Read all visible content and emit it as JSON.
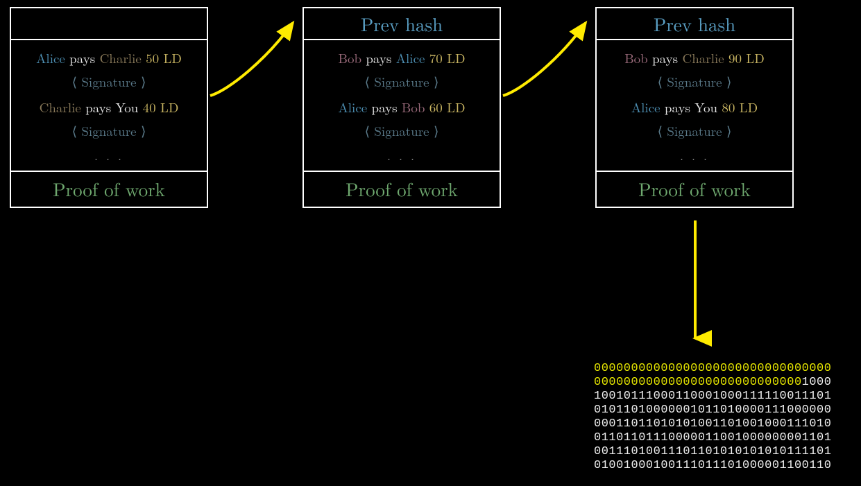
{
  "blocks": [
    {
      "header_label": "",
      "transactions": [
        {
          "from": "Alice",
          "to": "Charlie",
          "amount": "50 LD",
          "signature_label": "⟨ Signature ⟩"
        },
        {
          "from": "Charlie",
          "to": "You",
          "amount": "40 LD",
          "signature_label": "⟨ Signature ⟩"
        }
      ],
      "pays_word": "pays",
      "dots": ". . .",
      "footer_label": "Proof of work"
    },
    {
      "header_label": "Prev hash",
      "transactions": [
        {
          "from": "Bob",
          "to": "Alice",
          "amount": "70 LD",
          "signature_label": "⟨ Signature ⟩"
        },
        {
          "from": "Alice",
          "to": "Bob",
          "amount": "60 LD",
          "signature_label": "⟨ Signature ⟩"
        }
      ],
      "pays_word": "pays",
      "dots": ". . .",
      "footer_label": "Proof of work"
    },
    {
      "header_label": "Prev hash",
      "transactions": [
        {
          "from": "Bob",
          "to": "Charlie",
          "amount": "90 LD",
          "signature_label": "⟨ Signature ⟩"
        },
        {
          "from": "Alice",
          "to": "You",
          "amount": "80 LD",
          "signature_label": "⟨ Signature ⟩"
        }
      ],
      "pays_word": "pays",
      "dots": ". . .",
      "footer_label": "Proof of work"
    }
  ],
  "hash_output": {
    "zeros": "00000000000000000000000000000000\n0000000000000000000000000000",
    "rest": "1000\n10010111000110001000111110011101\n01011010000001011010000111000000\n00011011010101001101001000111010\n01101101110000011001000000001101\n00111010011101101010101010111101\n01001000100111011101000001100110"
  },
  "colors": {
    "arrow": "#ffeb00"
  }
}
